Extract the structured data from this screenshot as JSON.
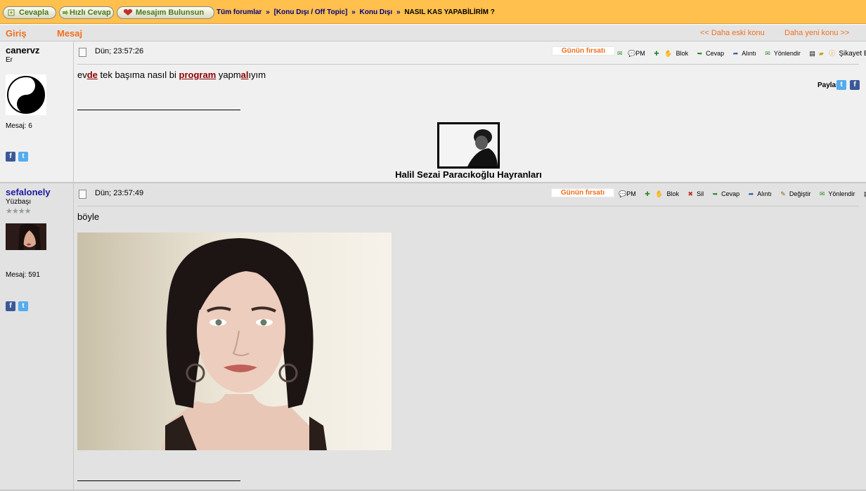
{
  "topbar": {
    "buttons": {
      "reply": "Cevapla",
      "quick_reply": "Hızlı Cevap",
      "find_my_message": "Mesajım Bulunsun"
    },
    "breadcrumb": {
      "all_forums": "Tüm forumlar",
      "sep": "»",
      "category": "[Konu Dışı / Off Topic]",
      "subforum": "Konu Dışı",
      "current": "NASIL KAS YAPABİLİRİM ?"
    }
  },
  "header": {
    "col_login": "Giriş",
    "col_message": "Mesaj",
    "older_topic": "<< Daha eski konu",
    "newer_topic": "Daha yeni konu >>"
  },
  "posts": [
    {
      "author": "canervz",
      "rank": "Er",
      "message_count": "Mesaj: 6",
      "date": "Dün; 23:57:26",
      "deal_label": "Günün fırsatı",
      "toolbar": {
        "pm": "PM",
        "block": "Blok",
        "reply": "Cevap",
        "quote": "Alıntı",
        "redirect": "Yönlendir",
        "report": "Şikayet Et"
      },
      "body": {
        "p1": "ev",
        "p2": "de",
        "p3": " tek başıma nasıl bi ",
        "p4": "program",
        "p5": " yapm",
        "p6": "al",
        "p7": "ıyım"
      },
      "share_label": "Paylaş:",
      "signature_caption": "Halil Sezai Paracıkoğlu Hayranları"
    },
    {
      "author": "sefalonely",
      "rank": "Yüzbaşı",
      "stars": "★★★★",
      "message_count": "Mesaj: 591",
      "date": "Dün; 23:57:49",
      "deal_label": "Günün fırsatı",
      "toolbar": {
        "pm": "PM",
        "block": "Blok",
        "delete": "Sil",
        "reply": "Cevap",
        "quote": "Alıntı",
        "edit": "Değiştir",
        "redirect": "Yönlendir"
      },
      "body_text": "böyle"
    }
  ],
  "colors": {
    "topbar": "#ffc04d",
    "accent_orange": "#f07020",
    "link_navy": "#000080",
    "underline_red": "#8b0000"
  }
}
